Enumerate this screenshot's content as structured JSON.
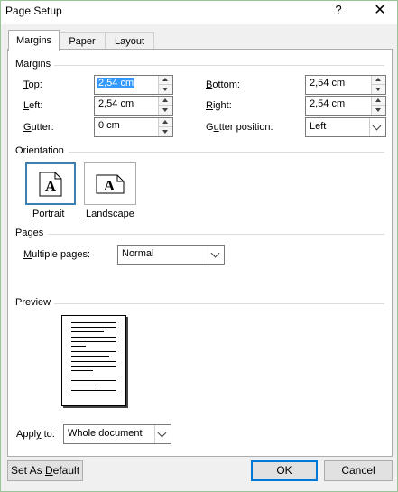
{
  "window": {
    "title": "Page Setup",
    "help_glyph": "?",
    "close_glyph": "✕"
  },
  "tabs": [
    {
      "label": "Margins",
      "active": true
    },
    {
      "label": "Paper",
      "active": false
    },
    {
      "label": "Layout",
      "active": false
    }
  ],
  "margins": {
    "section_label": "Margins",
    "top": {
      "label_accel": "T",
      "label_rest": "op:",
      "value": "2,54 cm"
    },
    "left": {
      "label_accel": "L",
      "label_rest": "eft:",
      "value": "2,54 cm"
    },
    "gutter": {
      "label_accel": "G",
      "label_rest": "utter:",
      "value": "0 cm"
    },
    "bottom": {
      "label_accel": "B",
      "label_rest": "ottom:",
      "value": "2,54 cm"
    },
    "right": {
      "label_accel": "R",
      "label_rest": "ight:",
      "value": "2,54 cm"
    },
    "gutter_position": {
      "label_pre": "G",
      "label_accel": "u",
      "label_rest": "tter position:",
      "value": "Left"
    }
  },
  "orientation": {
    "section_label": "Orientation",
    "portrait": {
      "label_accel": "P",
      "label_rest": "ortrait",
      "icon_glyph": "A",
      "selected": true
    },
    "landscape": {
      "label_accel": "L",
      "label_rest": "andscape",
      "icon_glyph": "A",
      "selected": false
    }
  },
  "pages": {
    "section_label": "Pages",
    "multiple_pages": {
      "label_accel": "M",
      "label_rest": "ultiple pages:",
      "value": "Normal"
    }
  },
  "preview": {
    "section_label": "Preview"
  },
  "apply_to": {
    "label_pre": "Appl",
    "label_accel": "y",
    "label_rest": " to:",
    "value": "Whole document"
  },
  "buttons": {
    "set_default": {
      "label_pre": "Set As ",
      "label_accel": "D",
      "label_rest": "efault"
    },
    "ok": "OK",
    "cancel": "Cancel"
  },
  "colors": {
    "accent": "#0078d7",
    "selection": "#3399ff",
    "orientation_selected": "#3c7fb1"
  }
}
